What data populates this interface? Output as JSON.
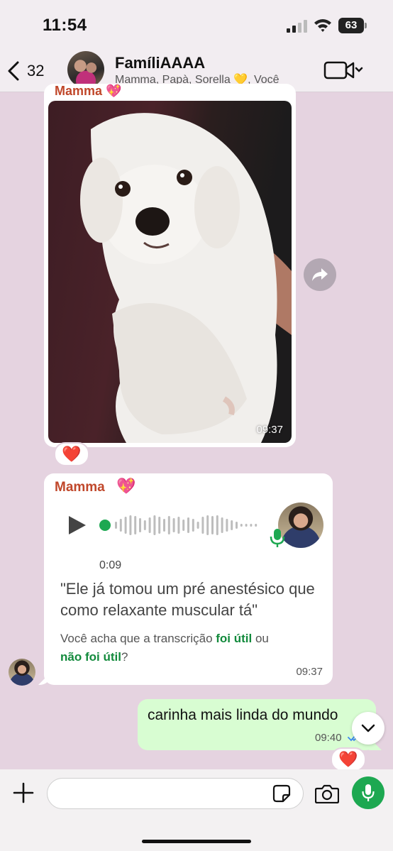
{
  "status_bar": {
    "time": "11:54",
    "battery": "63"
  },
  "header": {
    "back_count": "32",
    "group_name": "FamíliAAAA",
    "members": "Mamma, Papà, Sorella 💛, Você"
  },
  "messages": {
    "image": {
      "sender": "Mamma 💖",
      "time": "09:37",
      "reaction": "❤️"
    },
    "voice": {
      "sender": "Mamma",
      "sender_emoji": "💖",
      "duration": "0:09",
      "transcript": "\"Ele já tomou um pré anestésico que como relaxante muscular tá\"",
      "feedback_prefix": "Você acha que a transcrição ",
      "feedback_yes": "foi útil",
      "feedback_mid": " ou",
      "feedback_no": "não foi útil",
      "feedback_suffix": "?",
      "time": "09:37"
    },
    "outgoing": {
      "text": "carinha mais linda do mundo",
      "time": "09:40",
      "reaction": "❤️"
    }
  },
  "input": {
    "placeholder": ""
  },
  "colors": {
    "chat_bg": "#e5d3e0",
    "outgoing_bubble": "#d8fdd2",
    "sender_name": "#c0472a",
    "accent_green": "#1da851",
    "link_green": "#128a3c"
  },
  "icons": [
    "back-chevron",
    "video-camera",
    "forward-arrow",
    "play",
    "microphone",
    "chevron-down",
    "plus",
    "sticker",
    "camera"
  ]
}
